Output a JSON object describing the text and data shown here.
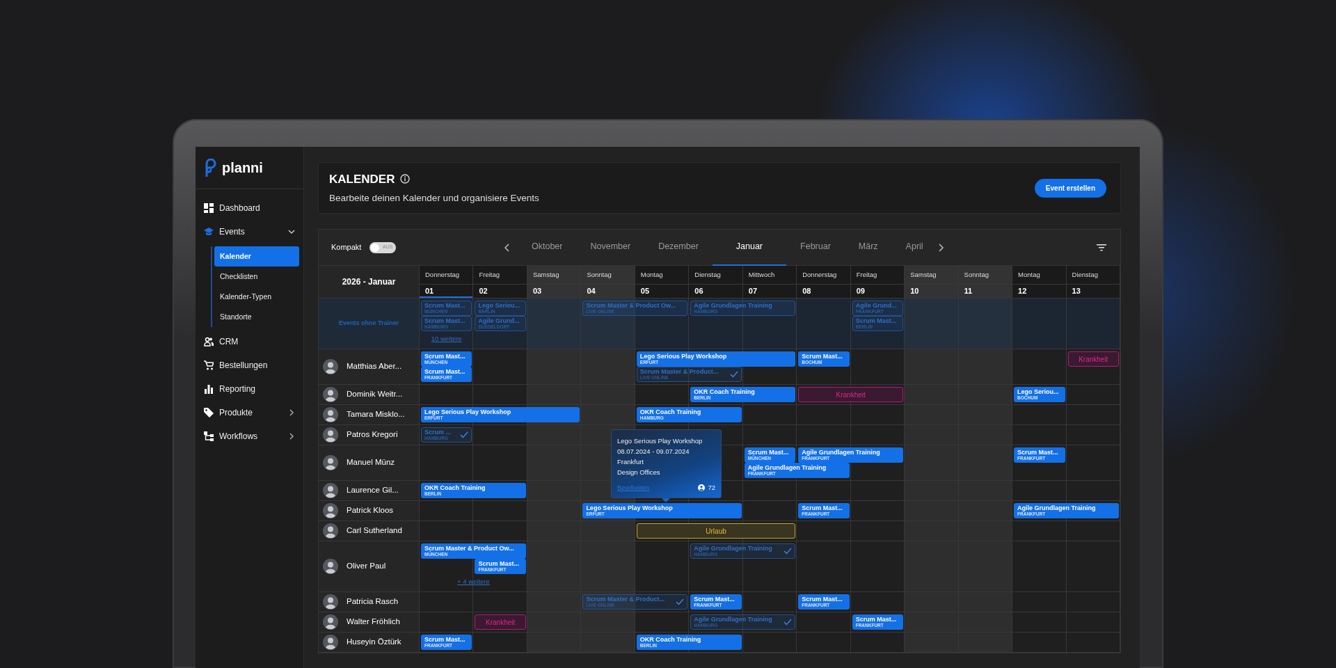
{
  "app": {
    "logo": "planni"
  },
  "sidebar": {
    "items": [
      {
        "label": "Dashboard",
        "active": false
      },
      {
        "label": "Events",
        "active": true,
        "expanded": true,
        "children": [
          {
            "label": "Kalender",
            "selected": true
          },
          {
            "label": "Checklisten",
            "selected": false
          },
          {
            "label": "Kalender-Typen",
            "selected": false
          },
          {
            "label": "Standorte",
            "selected": false
          }
        ]
      },
      {
        "label": "CRM",
        "active": false
      },
      {
        "label": "Bestellungen",
        "active": false
      },
      {
        "label": "Reporting",
        "active": false
      },
      {
        "label": "Produkte",
        "active": false,
        "expanded": false
      },
      {
        "label": "Workflows",
        "active": false,
        "expanded": false
      }
    ]
  },
  "header": {
    "title": "KALENDER",
    "subtitle": "Bearbeite deinen Kalender und organisiere Events",
    "button": "Event erstellen"
  },
  "toolbar": {
    "compact": {
      "label": "Kompakt",
      "on": false,
      "state_text": "AUS"
    },
    "months": [
      {
        "label": "Oktober",
        "selected": false
      },
      {
        "label": "November",
        "selected": false
      },
      {
        "label": "Dezember",
        "selected": false
      },
      {
        "label": "Januar",
        "selected": true
      },
      {
        "label": "Februar",
        "selected": false
      },
      {
        "label": "März",
        "selected": false
      },
      {
        "label": "April",
        "selected": false
      }
    ]
  },
  "calendar": {
    "title": "2026 - Januar",
    "days": [
      {
        "name": "Donnerstag",
        "date": "01",
        "weekend": false,
        "today": true
      },
      {
        "name": "Freitag",
        "date": "02",
        "weekend": false,
        "today": false
      },
      {
        "name": "Samstag",
        "date": "03",
        "weekend": true,
        "today": false
      },
      {
        "name": "Sonntag",
        "date": "04",
        "weekend": true,
        "today": false
      },
      {
        "name": "Montag",
        "date": "05",
        "weekend": false,
        "today": false
      },
      {
        "name": "Dienstag",
        "date": "06",
        "weekend": false,
        "today": false
      },
      {
        "name": "Mittwoch",
        "date": "07",
        "weekend": false,
        "today": false
      },
      {
        "name": "Donnerstag",
        "date": "08",
        "weekend": false,
        "today": false
      },
      {
        "name": "Freitag",
        "date": "09",
        "weekend": false,
        "today": false
      },
      {
        "name": "Samstag",
        "date": "10",
        "weekend": true,
        "today": false
      },
      {
        "name": "Sonntag",
        "date": "11",
        "weekend": true,
        "today": false
      },
      {
        "name": "Montag",
        "date": "12",
        "weekend": false,
        "today": false
      },
      {
        "name": "Dienstag",
        "date": "13",
        "weekend": false,
        "today": false
      }
    ],
    "rows": [
      {
        "kind": "unassigned",
        "label": "Events ohne Trainer",
        "lanes": [
          [
            {
              "kind": "open",
              "title": "Scrum Mast...",
              "location": "MÜNCHEN"
            },
            {
              "kind": "open",
              "title": "Lego Seriou...",
              "location": "BERLIN"
            },
            {
              "kind": "gap"
            },
            {
              "kind": "open",
              "title": "Scrum Master & Product Ow...",
              "location": "LIVE ONLINE"
            },
            {
              "kind": "continued"
            },
            {
              "kind": "open",
              "title": "Agile Grundlagen Training",
              "location": "HAMBURG"
            },
            {
              "kind": "continued"
            },
            {
              "kind": "gap"
            },
            {
              "kind": "open",
              "title": "Agile Grund...",
              "location": "FRANKFURT"
            }
          ],
          [
            {
              "kind": "open",
              "title": "Scrum Mast...",
              "location": "HAMBURG"
            },
            {
              "kind": "open",
              "title": "Agile Grund...",
              "location": "DÜSSELDORF"
            },
            {
              "kind": "gap"
            },
            {
              "kind": "gap"
            },
            {
              "kind": "gap"
            },
            {
              "kind": "gap"
            },
            {
              "kind": "gap"
            },
            {
              "kind": "gap"
            },
            {
              "kind": "open",
              "title": "Scrum Mast...",
              "location": "BERLIN"
            }
          ],
          [
            {
              "kind": "more",
              "label": "10 weitere"
            }
          ]
        ]
      },
      {
        "kind": "trainer",
        "trainer": "Matthias Aber...",
        "lanes": [
          [
            {
              "kind": "booked",
              "title": "Scrum Mast...",
              "location": "MÜNCHEN"
            },
            {
              "kind": "gap"
            },
            {
              "kind": "gap"
            },
            {
              "kind": "gap"
            },
            {
              "kind": "booked",
              "title": "Lego Serious Play Workshop",
              "location": "ERFURT"
            },
            {
              "kind": "continued"
            },
            {
              "kind": "continued"
            },
            {
              "kind": "booked",
              "title": "Scrum Mast...",
              "location": "BOCHUM"
            },
            {
              "kind": "gap"
            },
            {
              "kind": "gap"
            },
            {
              "kind": "gap"
            },
            {
              "kind": "gap"
            },
            {
              "kind": "sick",
              "title": "Krankheit"
            }
          ],
          [
            {
              "kind": "booked",
              "title": "Scrum Mast...",
              "location": "FRANKFURT"
            },
            {
              "kind": "gap"
            },
            {
              "kind": "gap"
            },
            {
              "kind": "gap"
            },
            {
              "kind": "confirmed",
              "title": "Scrum Master & Product...",
              "location": "LIVE ONLINE"
            },
            {
              "kind": "continued"
            }
          ]
        ]
      },
      {
        "kind": "trainer",
        "trainer": "Dominik Weitr...",
        "lanes": [
          [
            {
              "kind": "gap"
            },
            {
              "kind": "gap"
            },
            {
              "kind": "gap"
            },
            {
              "kind": "gap"
            },
            {
              "kind": "gap"
            },
            {
              "kind": "booked",
              "title": "OKR Coach Training",
              "location": "BERLIN"
            },
            {
              "kind": "continued"
            },
            {
              "kind": "sick",
              "title": "Krankheit"
            },
            {
              "kind": "continued"
            },
            {
              "kind": "gap"
            },
            {
              "kind": "gap"
            },
            {
              "kind": "booked",
              "title": "Lego Seriou...",
              "location": "BOCHUM"
            }
          ]
        ]
      },
      {
        "kind": "trainer",
        "trainer": "Tamara Misklo...",
        "lanes": [
          [
            {
              "kind": "booked",
              "title": "Lego Serious Play Workshop",
              "location": "ERFURT"
            },
            {
              "kind": "continued"
            },
            {
              "kind": "continued"
            },
            {
              "kind": "gap"
            },
            {
              "kind": "booked",
              "title": "OKR Coach Training",
              "location": "HAMBURG"
            },
            {
              "kind": "continued"
            }
          ]
        ]
      },
      {
        "kind": "trainer",
        "trainer": "Patros Kregori",
        "lanes": [
          [
            {
              "kind": "confirmed",
              "title": "Scrum ...",
              "location": "HAMBURG"
            }
          ]
        ]
      },
      {
        "kind": "trainer",
        "trainer": "Manuel Münz",
        "lanes": [
          [
            {
              "kind": "gap"
            },
            {
              "kind": "gap"
            },
            {
              "kind": "gap"
            },
            {
              "kind": "gap"
            },
            {
              "kind": "gap"
            },
            {
              "kind": "gap"
            },
            {
              "kind": "booked",
              "title": "Scrum Mast...",
              "location": "MÜNCHEN"
            },
            {
              "kind": "booked",
              "title": "Agile Grundlagen Training",
              "location": "FRANKFURT"
            },
            {
              "kind": "continued"
            },
            {
              "kind": "gap"
            },
            {
              "kind": "gap"
            },
            {
              "kind": "booked",
              "title": "Scrum Mast...",
              "location": "FRANKFURT"
            }
          ],
          [
            {
              "kind": "gap"
            },
            {
              "kind": "gap"
            },
            {
              "kind": "gap"
            },
            {
              "kind": "gap"
            },
            {
              "kind": "gap"
            },
            {
              "kind": "gap"
            },
            {
              "kind": "booked",
              "title": "Agile Grundlagen Training",
              "location": "FRANKFURT"
            },
            {
              "kind": "continued"
            }
          ]
        ]
      },
      {
        "kind": "trainer",
        "trainer": "Laurence Gil...",
        "lanes": [
          [
            {
              "kind": "booked",
              "title": "OKR Coach Training",
              "location": "BERLIN"
            },
            {
              "kind": "continued"
            }
          ]
        ]
      },
      {
        "kind": "trainer",
        "trainer": "Patrick Kloos",
        "lanes": [
          [
            {
              "kind": "gap"
            },
            {
              "kind": "gap"
            },
            {
              "kind": "gap"
            },
            {
              "kind": "booked",
              "title": "Lego Serious Play Workshop",
              "location": "ERFURT",
              "popover": {
                "title": "Lego Serious Play Workshop",
                "dates": "08.07.2024 - 09.07.2024",
                "city": "Frankfurt",
                "venue": "Design Offices",
                "link": "Bearbeiten",
                "participants": "72"
              }
            },
            {
              "kind": "continued"
            },
            {
              "kind": "continued"
            },
            {
              "kind": "gap"
            },
            {
              "kind": "booked",
              "title": "Scrum Mast...",
              "location": "FRANKFURT"
            },
            {
              "kind": "gap"
            },
            {
              "kind": "gap"
            },
            {
              "kind": "gap"
            },
            {
              "kind": "booked",
              "title": "Agile Grundlagen Training",
              "location": "FRANKFURT"
            },
            {
              "kind": "continued"
            }
          ]
        ]
      },
      {
        "kind": "trainer",
        "trainer": "Carl Sutherland",
        "lanes": [
          [
            {
              "kind": "gap"
            },
            {
              "kind": "gap"
            },
            {
              "kind": "gap"
            },
            {
              "kind": "gap"
            },
            {
              "kind": "vacation",
              "title": "Urlaub"
            },
            {
              "kind": "continued"
            },
            {
              "kind": "continued"
            }
          ]
        ]
      },
      {
        "kind": "trainer",
        "trainer": "Oliver Paul",
        "lanes": [
          [
            {
              "kind": "booked",
              "title": "Scrum Master & Product Ow...",
              "location": "MÜNCHEN"
            },
            {
              "kind": "continued"
            },
            {
              "kind": "gap"
            },
            {
              "kind": "gap"
            },
            {
              "kind": "gap"
            },
            {
              "kind": "confirmed",
              "title": "Agile Grundlagen Training",
              "location": "HAMBURG"
            },
            {
              "kind": "continued"
            }
          ],
          [
            {
              "kind": "gap"
            },
            {
              "kind": "booked",
              "title": "Scrum Mast...",
              "location": "FRANKFURT"
            }
          ],
          [
            {
              "kind": "more",
              "label": "+ 4 weitere"
            },
            {
              "kind": "continued"
            }
          ]
        ]
      },
      {
        "kind": "trainer",
        "trainer": "Patricia Rasch",
        "lanes": [
          [
            {
              "kind": "gap"
            },
            {
              "kind": "gap"
            },
            {
              "kind": "gap"
            },
            {
              "kind": "confirmed",
              "title": "Scrum Master & Product...",
              "location": "LIVE ONLINE"
            },
            {
              "kind": "continued"
            },
            {
              "kind": "booked",
              "title": "Scrum Mast...",
              "location": "FRANKFURT"
            },
            {
              "kind": "gap"
            },
            {
              "kind": "booked",
              "title": "Scrum Mast...",
              "location": "FRANKFURT"
            }
          ]
        ]
      },
      {
        "kind": "trainer",
        "trainer": "Walter Fröhlich",
        "lanes": [
          [
            {
              "kind": "gap"
            },
            {
              "kind": "sick",
              "title": "Krankheit"
            },
            {
              "kind": "gap"
            },
            {
              "kind": "gap"
            },
            {
              "kind": "gap"
            },
            {
              "kind": "confirmed",
              "title": "Agile Grundlagen Training",
              "location": "HAMBURG"
            },
            {
              "kind": "continued"
            },
            {
              "kind": "gap"
            },
            {
              "kind": "booked",
              "title": "Scrum Mast...",
              "location": "FRANKFURT"
            }
          ]
        ]
      },
      {
        "kind": "trainer",
        "trainer": "Huseyin Öztürk",
        "lanes": [
          [
            {
              "kind": "booked",
              "title": "Scrum Mast...",
              "location": "FRANKFURT"
            },
            {
              "kind": "gap"
            },
            {
              "kind": "gap"
            },
            {
              "kind": "gap"
            },
            {
              "kind": "booked",
              "title": "OKR Coach Training",
              "location": "BERLIN"
            },
            {
              "kind": "continued"
            }
          ]
        ]
      }
    ]
  }
}
